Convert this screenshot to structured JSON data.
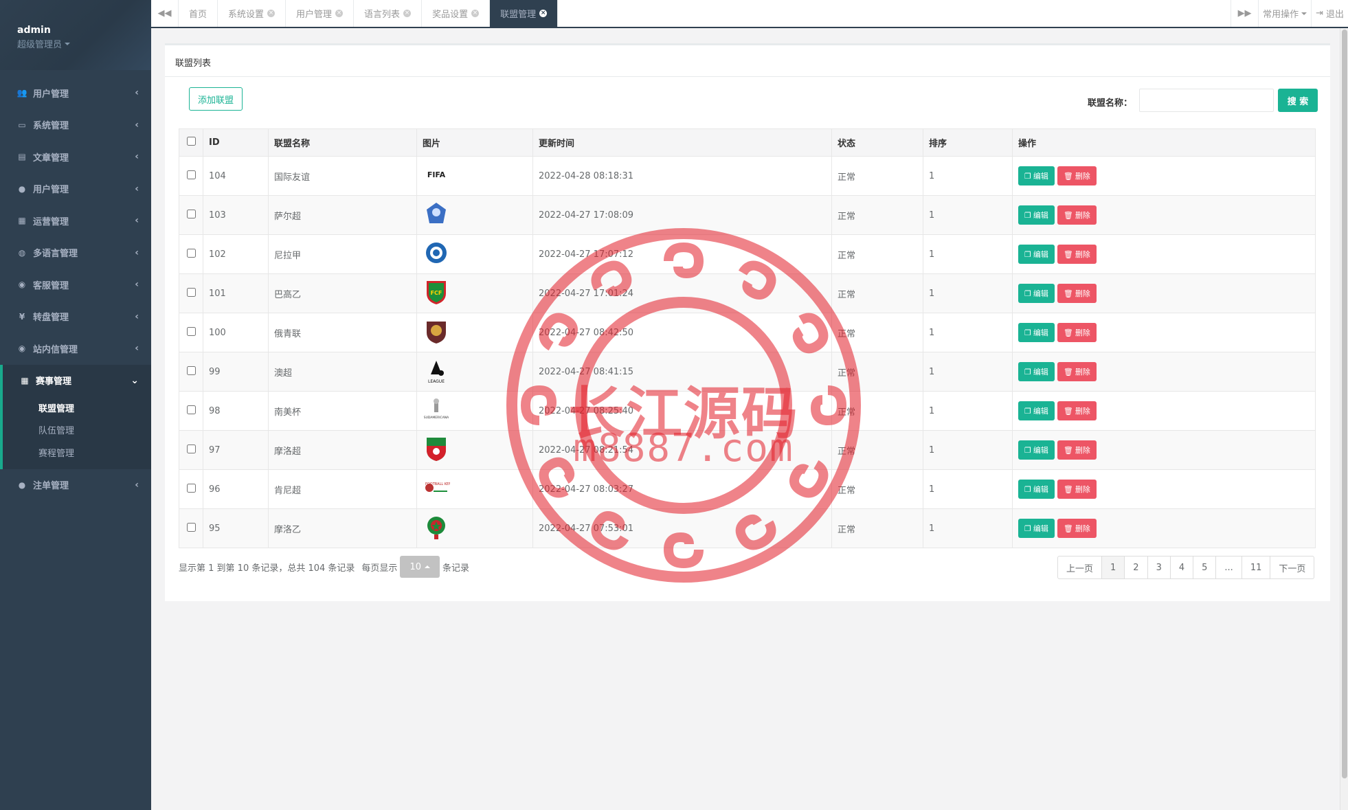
{
  "user": {
    "name": "admin",
    "role": "超级管理员"
  },
  "sidebar": {
    "items": [
      {
        "icon": "users-icon",
        "glyph": "👥",
        "label": "用户管理"
      },
      {
        "icon": "desktop-icon",
        "glyph": "▭",
        "label": "系统管理"
      },
      {
        "icon": "book-icon",
        "glyph": "▤",
        "label": "文章管理"
      },
      {
        "icon": "user-icon",
        "glyph": "●",
        "label": "用户管理"
      },
      {
        "icon": "chart-icon",
        "glyph": "▦",
        "label": "运营管理"
      },
      {
        "icon": "globe-icon",
        "glyph": "◍",
        "label": "多语言管理"
      },
      {
        "icon": "comment-icon",
        "glyph": "◉",
        "label": "客服管理"
      },
      {
        "icon": "yen-icon",
        "glyph": "¥",
        "label": "转盘管理"
      },
      {
        "icon": "comment-icon",
        "glyph": "◉",
        "label": "站内信管理"
      }
    ],
    "active_item": {
      "icon": "chart-icon",
      "glyph": "▦",
      "label": "赛事管理"
    },
    "sub_items": [
      "联盟管理",
      "队伍管理",
      "赛程管理"
    ],
    "last_item": {
      "icon": "user-icon",
      "glyph": "●",
      "label": "注单管理"
    }
  },
  "tabs": [
    "首页",
    "系统设置",
    "用户管理",
    "语言列表",
    "奖品设置",
    "联盟管理"
  ],
  "top_right": {
    "common_ops": "常用操作",
    "logout": "退出"
  },
  "panel": {
    "title": "联盟列表"
  },
  "toolbar": {
    "add_label": "添加联盟",
    "search_label": "联盟名称：",
    "search_value": "",
    "search_button": "搜 索"
  },
  "table": {
    "headers": [
      "ID",
      "联盟名称",
      "图片",
      "更新时间",
      "状态",
      "排序",
      "操作"
    ],
    "rows": [
      {
        "id": "104",
        "name": "国际友谊",
        "logo": "FIFA",
        "time": "2022-04-28 08:18:31",
        "status": "正常",
        "sort": "1"
      },
      {
        "id": "103",
        "name": "萨尔超",
        "logo": "",
        "time": "2022-04-27 17:08:09",
        "status": "正常",
        "sort": "1"
      },
      {
        "id": "102",
        "name": "尼拉甲",
        "logo": "",
        "time": "2022-04-27 17:07:12",
        "status": "正常",
        "sort": "1"
      },
      {
        "id": "101",
        "name": "巴高乙",
        "logo": "FCF",
        "time": "2022-04-27 17:01:24",
        "status": "正常",
        "sort": "1"
      },
      {
        "id": "100",
        "name": "俄青联",
        "logo": "",
        "time": "2022-04-27 08:42:50",
        "status": "正常",
        "sort": "1"
      },
      {
        "id": "99",
        "name": "澳超",
        "logo": "LEAGUE",
        "time": "2022-04-27 08:41:15",
        "status": "正常",
        "sort": "1"
      },
      {
        "id": "98",
        "name": "南美杯",
        "logo": "SUDAMERICANA",
        "time": "2022-04-27 08:25:40",
        "status": "正常",
        "sort": "1"
      },
      {
        "id": "97",
        "name": "摩洛超",
        "logo": "",
        "time": "2022-04-27 08:21:54",
        "status": "正常",
        "sort": "1"
      },
      {
        "id": "96",
        "name": "肯尼超",
        "logo": "FOOTBALL KENYA",
        "time": "2022-04-27 08:03:27",
        "status": "正常",
        "sort": "1"
      },
      {
        "id": "95",
        "name": "摩洛乙",
        "logo": "",
        "time": "2022-04-27 07:53:01",
        "status": "正常",
        "sort": "1"
      }
    ],
    "edit_label": "编辑",
    "delete_label": "删除"
  },
  "footer": {
    "info_prefix": "显示第 1 到第 10 条记录，总共 104 条记录",
    "per_page_label": "每页显示",
    "page_size": "10",
    "per_page_suffix": "条记录"
  },
  "pagination": [
    "上一页",
    "1",
    "2",
    "3",
    "4",
    "5",
    "...",
    "11",
    "下一页"
  ],
  "watermark": {
    "text": "长江源码",
    "url": "m8887.com"
  },
  "colors": {
    "sidebar_bg": "#2f4050",
    "accent": "#1ab394",
    "danger": "#ed5565",
    "watermark": "#e11e28"
  }
}
